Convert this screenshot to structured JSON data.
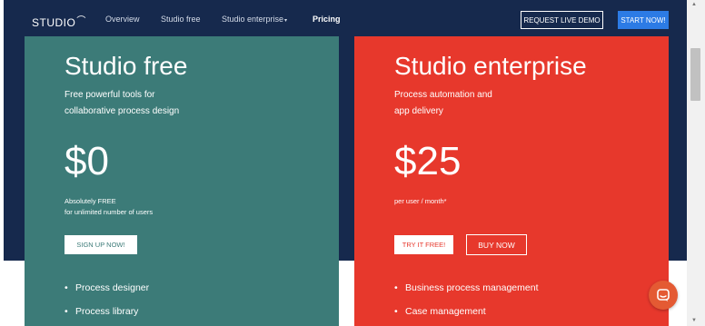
{
  "nav": {
    "logo": "STUDIO",
    "links": [
      "Overview",
      "Studio free",
      "Studio enterprise",
      "Pricing"
    ],
    "dropdown_caret": "▾",
    "demo_label": "REQUEST LIVE DEMO",
    "start_label": "START NOW!"
  },
  "cards": {
    "free": {
      "title": "Studio free",
      "subtitle": "Free powerful tools for\ncollaborative process design",
      "price": "$0",
      "price_note": "Absolutely FREE\nfor unlimited number of users",
      "cta": "SIGN UP NOW!",
      "features": [
        "Process designer",
        "Process library"
      ]
    },
    "enterprise": {
      "title": "Studio enterprise",
      "subtitle": "Process automation and\napp delivery",
      "price": "$25",
      "price_note": "per user / month*",
      "cta_primary": "TRY IT FREE!",
      "cta_secondary": "BUY NOW",
      "features": [
        "Business process management",
        "Case management"
      ]
    }
  },
  "colors": {
    "hero_bg": "#16294d",
    "free_card": "#3c7b78",
    "enterprise_card": "#e7382c",
    "start_button": "#2c7be5",
    "chat_button": "#e45a33"
  },
  "icons": {
    "chat": "chat-bubble-icon",
    "scroll_up": "arrow-up-icon",
    "scroll_down": "arrow-down-icon"
  }
}
